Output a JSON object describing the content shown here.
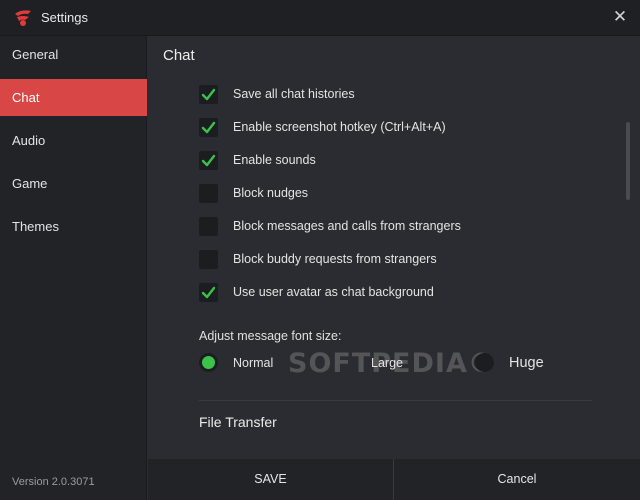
{
  "window": {
    "title": "Settings",
    "close_glyph": "✕"
  },
  "sidebar": {
    "items": [
      {
        "label": "General",
        "active": false
      },
      {
        "label": "Chat",
        "active": true
      },
      {
        "label": "Audio",
        "active": false
      },
      {
        "label": "Game",
        "active": false
      },
      {
        "label": "Themes",
        "active": false
      }
    ],
    "version": "Version 2.0.3071"
  },
  "chat": {
    "title": "Chat",
    "options": [
      {
        "label": "Save all chat histories",
        "checked": true
      },
      {
        "label": "Enable screenshot hotkey (Ctrl+Alt+A)",
        "checked": true
      },
      {
        "label": "Enable sounds",
        "checked": true
      },
      {
        "label": "Block nudges",
        "checked": false
      },
      {
        "label": "Block messages and calls from strangers",
        "checked": false
      },
      {
        "label": "Block buddy requests from strangers",
        "checked": false
      },
      {
        "label": "Use user avatar as chat background",
        "checked": true
      }
    ],
    "font_size": {
      "label": "Adjust message font size:",
      "options": [
        "Normal",
        "Large",
        "Huge"
      ],
      "selected": "Normal"
    },
    "file_transfer_title": "File Transfer"
  },
  "watermark": "SOFTPEDIA®",
  "footer": {
    "save_label": "SAVE",
    "cancel_label": "Cancel"
  },
  "colors": {
    "accent": "#d94646",
    "check": "#3cc24a",
    "background": "#2b2c31",
    "sidebar": "#222327"
  },
  "icons": {
    "logo": "garena-logo-icon",
    "close": "close-icon",
    "check": "checkmark-icon"
  }
}
